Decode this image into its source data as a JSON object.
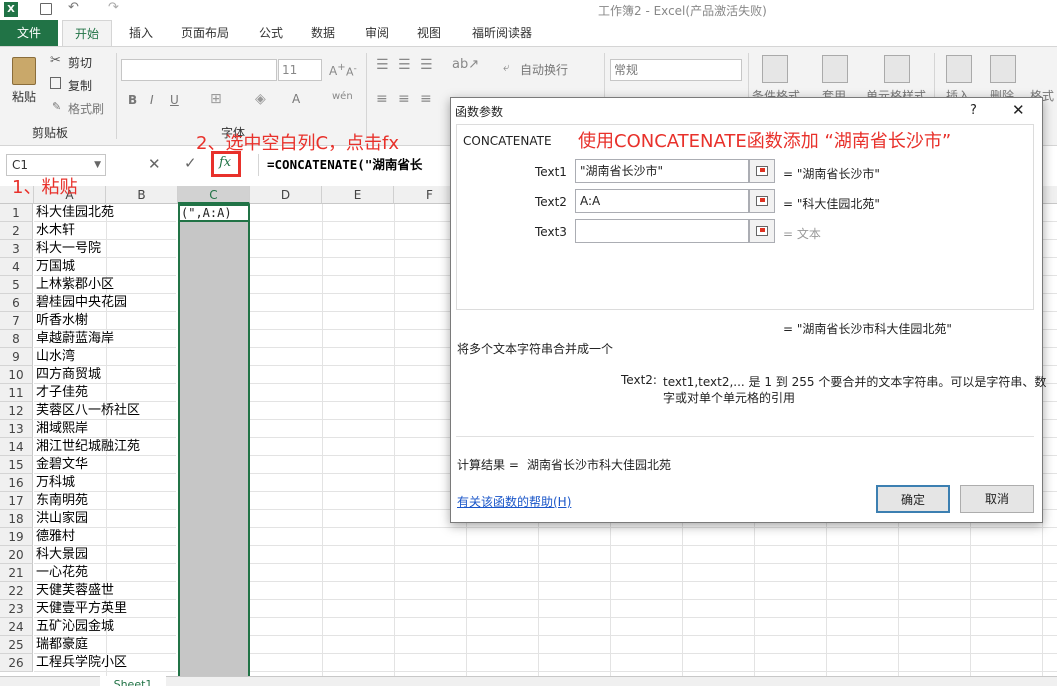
{
  "window": {
    "title": "工作簿2 - Excel(产品激活失败)"
  },
  "tabs": {
    "file": "文件",
    "home": "开始",
    "insert": "插入",
    "layout": "页面布局",
    "formulas": "公式",
    "data": "数据",
    "review": "审阅",
    "view": "视图",
    "foxit": "福昕阅读器"
  },
  "ribbon": {
    "paste": "粘贴",
    "cut": "剪切",
    "copy": "复制",
    "format_painter": "格式刷",
    "clipboard": "剪贴板",
    "font_size": "11",
    "font_group": "字体",
    "wrap_text": "自动换行",
    "number_format": "常规",
    "conditional": "条件格式",
    "table_fmt": "套用",
    "cell_style": "单元格样式",
    "insert": "插入",
    "delete": "删除",
    "format": "格式"
  },
  "formula_bar": {
    "name_box": "C1",
    "formula": "=CONCATENATE(\"湖南省长"
  },
  "annotations": {
    "step1": "1、粘贴",
    "step2": "2、选中空白列C，点击fx",
    "step3": "使用CONCATENATE函数添加 “湖南省长沙市”"
  },
  "grid": {
    "columns": [
      "A",
      "B",
      "C",
      "D",
      "E",
      "F"
    ],
    "c1_value": "(\",A:A)",
    "rows": [
      {
        "n": "1",
        "a": "科大佳园北苑"
      },
      {
        "n": "2",
        "a": "水木轩"
      },
      {
        "n": "3",
        "a": "科大一号院"
      },
      {
        "n": "4",
        "a": "万国城"
      },
      {
        "n": "5",
        "a": "上林紫郡小区"
      },
      {
        "n": "6",
        "a": "碧桂园中央花园"
      },
      {
        "n": "7",
        "a": "听香水榭"
      },
      {
        "n": "8",
        "a": "卓越蔚蓝海岸"
      },
      {
        "n": "9",
        "a": "山水湾"
      },
      {
        "n": "10",
        "a": "四方商贸城"
      },
      {
        "n": "11",
        "a": "才子佳苑"
      },
      {
        "n": "12",
        "a": "芙蓉区八一桥社区"
      },
      {
        "n": "13",
        "a": "湘域熙岸"
      },
      {
        "n": "14",
        "a": "湘江世纪城融江苑"
      },
      {
        "n": "15",
        "a": "金碧文华"
      },
      {
        "n": "16",
        "a": "万科城"
      },
      {
        "n": "17",
        "a": "东南明苑"
      },
      {
        "n": "18",
        "a": "洪山家园"
      },
      {
        "n": "19",
        "a": "德雅村"
      },
      {
        "n": "20",
        "a": "科大景园"
      },
      {
        "n": "21",
        "a": "一心花苑"
      },
      {
        "n": "22",
        "a": "天健芙蓉盛世"
      },
      {
        "n": "23",
        "a": "天健壹平方英里"
      },
      {
        "n": "24",
        "a": "五矿沁园金城"
      },
      {
        "n": "25",
        "a": "瑞都豪庭"
      },
      {
        "n": "26",
        "a": "工程兵学院小区"
      }
    ]
  },
  "dialog": {
    "title": "函数参数",
    "help": "?",
    "close": "✕",
    "function_name": "CONCATENATE",
    "args": [
      {
        "label": "Text1",
        "value": "\"湖南省长沙市\"",
        "result": "= \"湖南省长沙市\""
      },
      {
        "label": "Text2",
        "value": "A:A",
        "result": "= \"科大佳园北苑\""
      },
      {
        "label": "Text3",
        "value": "",
        "result": "= 文本"
      }
    ],
    "total_result": "= \"湖南省长沙市科大佳园北苑\"",
    "description": "将多个文本字符串合并成一个",
    "arg_help_label": "Text2:",
    "arg_help_line1": "text1,text2,... 是 1 到 255 个要合并的文本字符串。可以是字符串、数",
    "arg_help_line2": "字或对单个单元格的引用",
    "calc_label": "计算结果 =",
    "calc_value": "湖南省长沙市科大佳园北苑",
    "help_link": "有关该函数的帮助(H)",
    "ok": "确定",
    "cancel": "取消"
  },
  "sheet_tab": "Sheet1",
  "colors": {
    "accent": "#217346",
    "annotation": "#e8312b",
    "selection": "#c6c6c6"
  }
}
